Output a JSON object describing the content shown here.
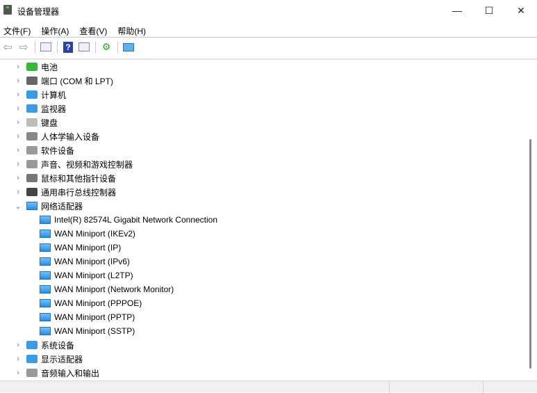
{
  "window": {
    "title": "设备管理器",
    "minimize": "—",
    "maximize": "☐",
    "close": "✕"
  },
  "menu": [
    "文件(F)",
    "操作(A)",
    "查看(V)",
    "帮助(H)"
  ],
  "toolbar": [
    "back-icon",
    "forward-icon",
    "show-hide-console-tree-icon",
    "help-icon",
    "properties-icon",
    "update-driver-icon",
    "scan-hardware-icon"
  ],
  "tree": {
    "categories_top": [
      {
        "label": "电池",
        "icon": "battery-icon"
      },
      {
        "label": "端口 (COM 和 LPT)",
        "icon": "port-icon"
      },
      {
        "label": "计算机",
        "icon": "computer-icon"
      },
      {
        "label": "监视器",
        "icon": "monitor-icon"
      },
      {
        "label": "键盘",
        "icon": "keyboard-icon"
      },
      {
        "label": "人体学输入设备",
        "icon": "hid-icon"
      },
      {
        "label": "软件设备",
        "icon": "software-device-icon"
      },
      {
        "label": "声音、视频和游戏控制器",
        "icon": "speaker-icon"
      },
      {
        "label": "鼠标和其他指针设备",
        "icon": "mouse-icon"
      },
      {
        "label": "通用串行总线控制器",
        "icon": "usb-icon"
      }
    ],
    "expanded": {
      "label": "网络适配器",
      "icon": "network-adapter-icon",
      "children": [
        "Intel(R) 82574L Gigabit Network Connection",
        "WAN Miniport (IKEv2)",
        "WAN Miniport (IP)",
        "WAN Miniport (IPv6)",
        "WAN Miniport (L2TP)",
        "WAN Miniport (Network Monitor)",
        "WAN Miniport (PPPOE)",
        "WAN Miniport (PPTP)",
        "WAN Miniport (SSTP)"
      ]
    },
    "categories_bottom": [
      {
        "label": "系统设备",
        "icon": "system-device-icon"
      },
      {
        "label": "显示适配器",
        "icon": "display-adapter-icon"
      },
      {
        "label": "音频输入和输出",
        "icon": "audio-icon"
      }
    ]
  }
}
